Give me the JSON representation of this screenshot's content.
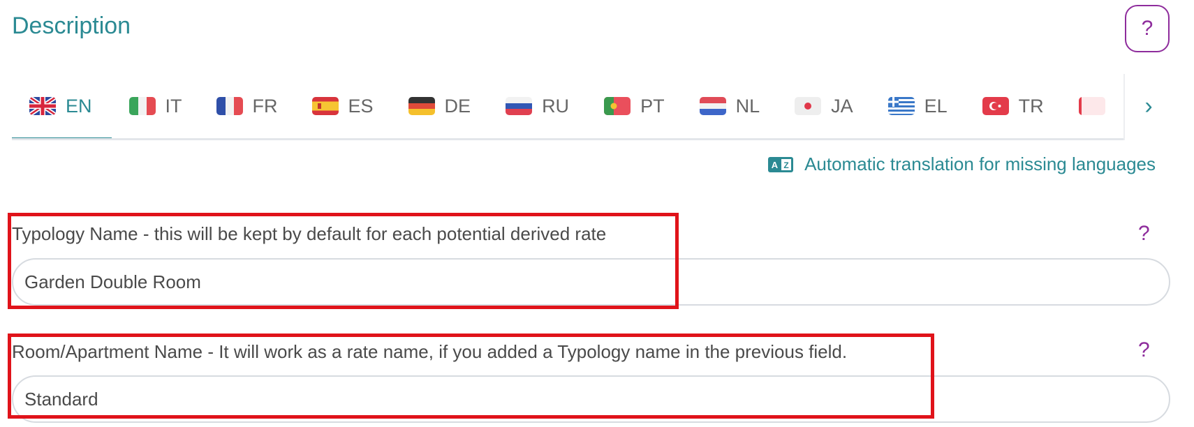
{
  "section": {
    "title": "Description",
    "help_glyph": "?"
  },
  "tabs": [
    {
      "code": "EN",
      "flag": "gb-flag-icon",
      "active": true
    },
    {
      "code": "IT",
      "flag": "it-flag-icon",
      "active": false
    },
    {
      "code": "FR",
      "flag": "fr-flag-icon",
      "active": false
    },
    {
      "code": "ES",
      "flag": "es-flag-icon",
      "active": false
    },
    {
      "code": "DE",
      "flag": "de-flag-icon",
      "active": false
    },
    {
      "code": "RU",
      "flag": "ru-flag-icon",
      "active": false
    },
    {
      "code": "PT",
      "flag": "pt-flag-icon",
      "active": false
    },
    {
      "code": "NL",
      "flag": "nl-flag-icon",
      "active": false
    },
    {
      "code": "JA",
      "flag": "jp-flag-icon",
      "active": false
    },
    {
      "code": "EL",
      "flag": "gr-flag-icon",
      "active": false
    },
    {
      "code": "TR",
      "flag": "tr-flag-icon",
      "active": false
    }
  ],
  "tabs_next_glyph": "›",
  "auto_translate": {
    "label": "Automatic translation for missing languages",
    "icon": "translate-icon"
  },
  "fields": {
    "typology": {
      "label": "Typology Name - this will be kept by default for each potential derived rate",
      "value": "Garden Double Room",
      "help_glyph": "?"
    },
    "room_name": {
      "label": "Room/Apartment Name - It will work as a rate name, if you added a Typology name in the previous field.",
      "value": "Standard",
      "help_glyph": "?"
    }
  },
  "colors": {
    "accent": "#2b8a93",
    "help": "#8e2c9c",
    "highlight": "#e0131a"
  }
}
